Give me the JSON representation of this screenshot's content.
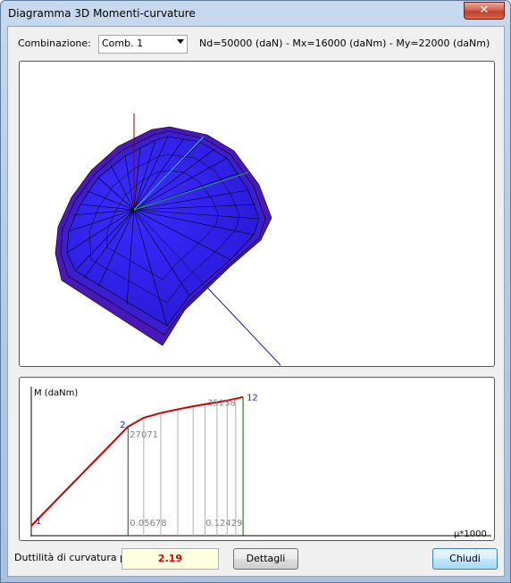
{
  "window": {
    "title": "Diagramma 3D Momenti-curvature",
    "close_label": "✕"
  },
  "toolbar": {
    "combination_label": "Combinazione:",
    "combination_value": "Comb. 1",
    "forces_text": "Nd=50000 (daN) - Mx=16000 (daNm) - My=22000 (daNm)"
  },
  "chart_data": {
    "type": "line",
    "ylabel": "M (daNm)",
    "xlabel": "μ*1000",
    "points": [
      {
        "x": 0.0,
        "y": 0
      },
      {
        "x": 0.05678,
        "y": 27071
      },
      {
        "x": 0.066,
        "y": 29500
      },
      {
        "x": 0.076,
        "y": 30800
      },
      {
        "x": 0.086,
        "y": 31800
      },
      {
        "x": 0.095,
        "y": 32600
      },
      {
        "x": 0.102,
        "y": 33200
      },
      {
        "x": 0.109,
        "y": 33700
      },
      {
        "x": 0.115,
        "y": 34200
      },
      {
        "x": 0.12,
        "y": 34700
      },
      {
        "x": 0.12429,
        "y": 35158
      }
    ],
    "point_labels": [
      {
        "index": 0,
        "text": "1"
      },
      {
        "index": 1,
        "text": "2"
      },
      {
        "index": 10,
        "text": "12"
      }
    ],
    "value_labels": [
      "27071",
      "35158",
      "0.05678",
      "0.12429"
    ],
    "xlim": [
      0,
      0.27
    ],
    "ylim": [
      0,
      38000
    ],
    "colors": {
      "curve": "#cc0000",
      "yield_line": "#006400",
      "grid": "#b0b0b0",
      "point_label": "#1c1cb4"
    }
  },
  "footer": {
    "ductility_label": "Duttilità di curvatura μf:",
    "ductility_value": "2.19",
    "details_button": "Dettagli",
    "close_button": "Chiudi"
  }
}
